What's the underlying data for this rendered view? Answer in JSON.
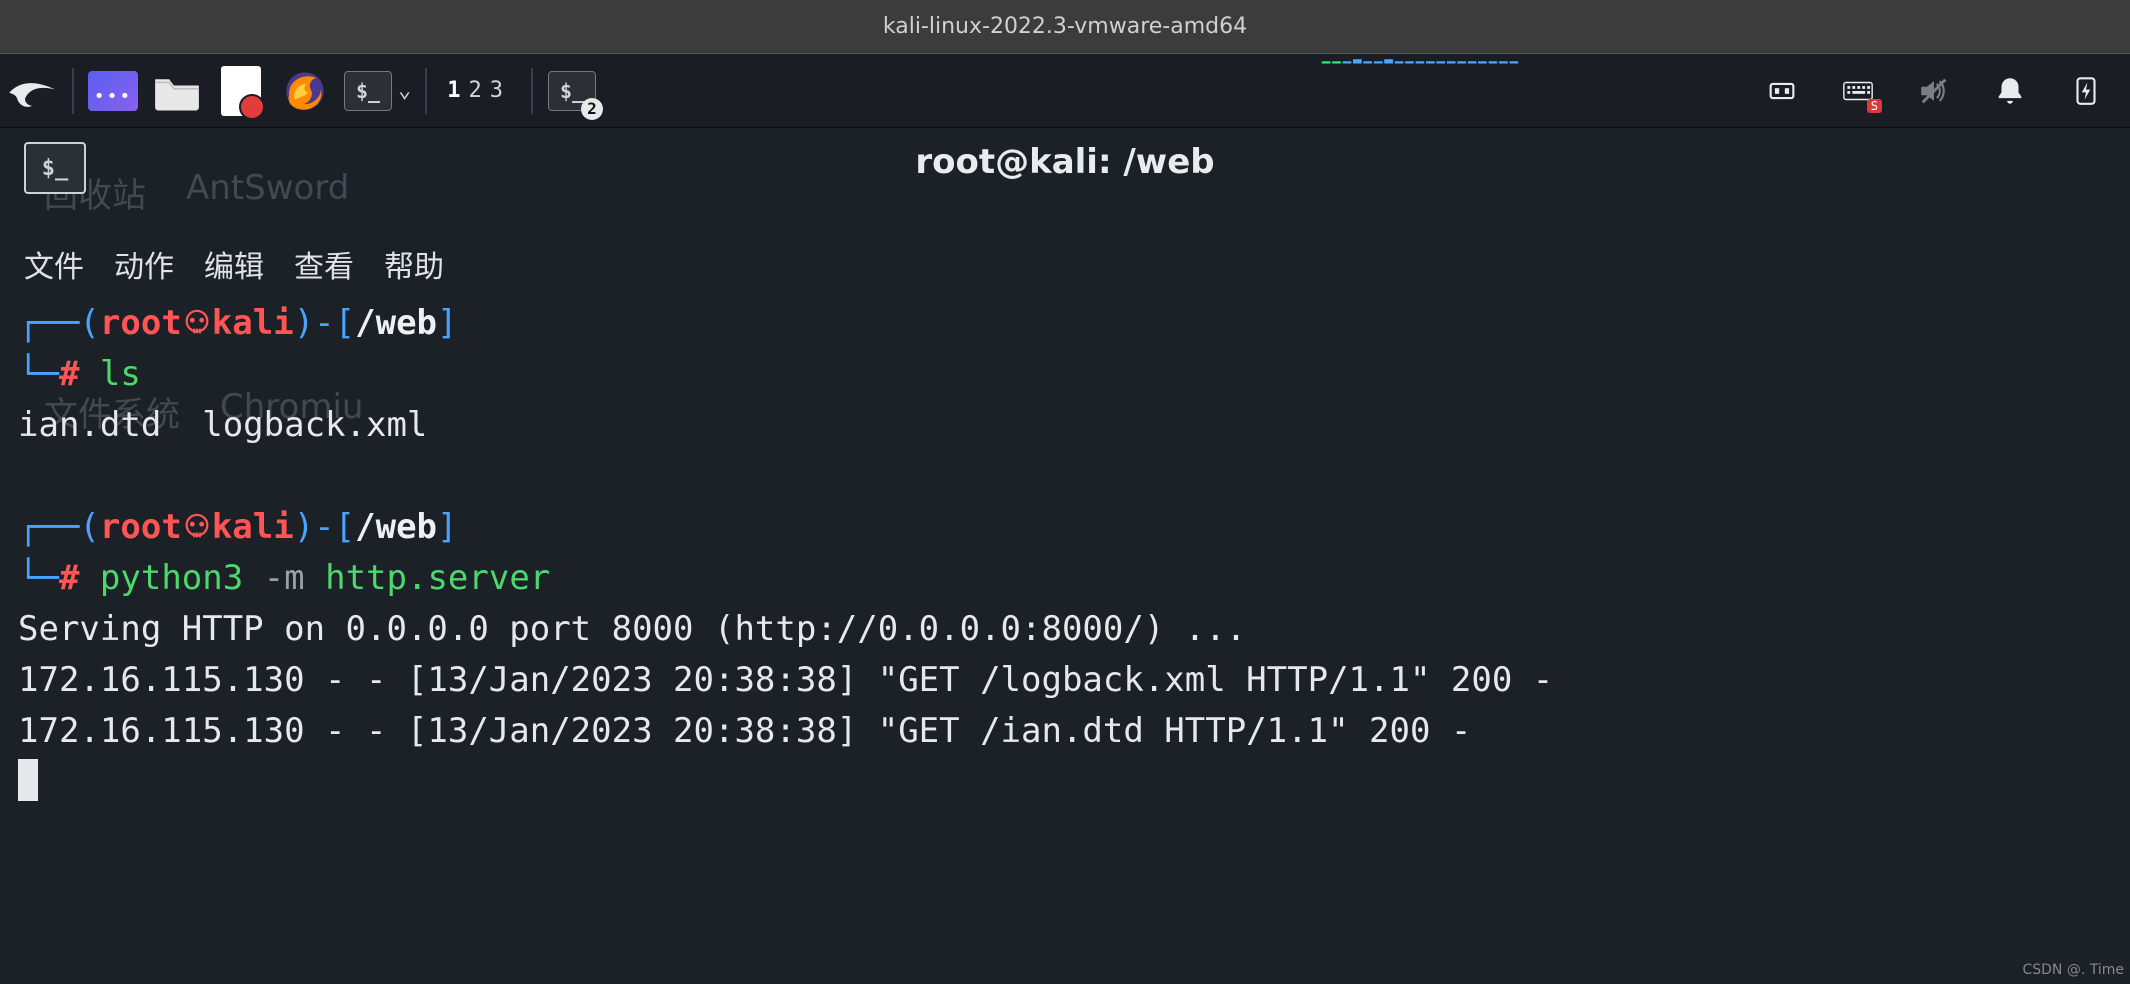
{
  "vm": {
    "title": "kali-linux-2022.3-vmware-amd64"
  },
  "taskbar": {
    "workspaces": [
      "1",
      "2",
      "3"
    ],
    "active_workspace": "1",
    "term_badge": "2",
    "kbd_badge": "S"
  },
  "desktop_ghost": {
    "r1a": "回收站",
    "r1b": "AntSword",
    "r2a": "文件系统",
    "r2b": "Chromiu"
  },
  "window": {
    "title": "root@kali: /web",
    "menu": [
      "文件",
      "动作",
      "编辑",
      "查看",
      "帮助"
    ]
  },
  "prompt": {
    "l_paren": "(",
    "user": "root",
    "at": "㉿",
    "host": "kali",
    "r_paren": ")",
    "dash": "-",
    "l_brk": "[",
    "path": "/web",
    "r_brk": "]",
    "hash": "#"
  },
  "cmd1": "ls",
  "out1": "ian.dtd  logback.xml",
  "cmd2": {
    "part1": "python3 ",
    "flag": "-m",
    "part2": " http.server"
  },
  "server_start": "Serving HTTP on 0.0.0.0 port 8000 (http://0.0.0.0:8000/) ...",
  "log1": "172.16.115.130 - - [13/Jan/2023 20:38:38] \"GET /logback.xml HTTP/1.1\" 200 -",
  "log2": "172.16.115.130 - - [13/Jan/2023 20:38:38] \"GET /ian.dtd HTTP/1.1\" 200 -",
  "watermark": "CSDN @. Time"
}
